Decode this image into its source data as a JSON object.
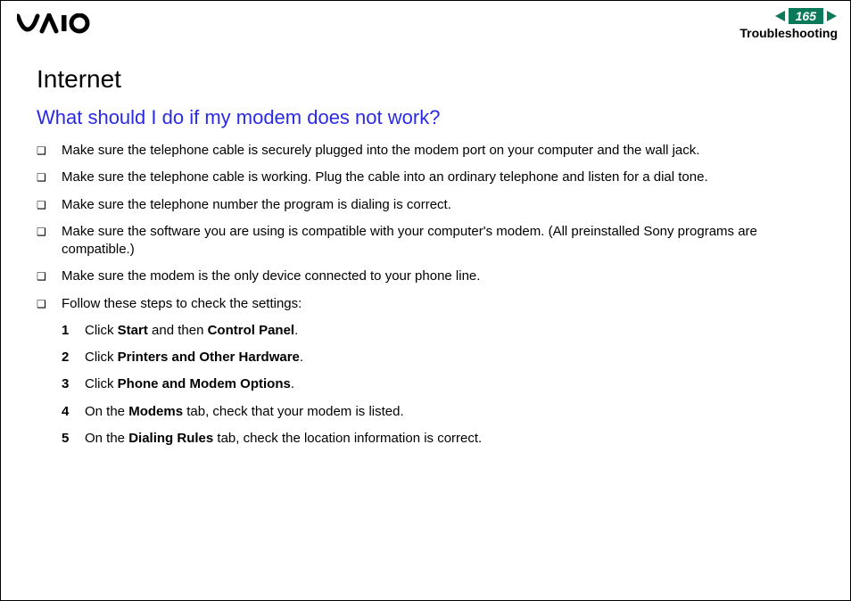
{
  "header": {
    "page_number": "165",
    "section": "Troubleshooting"
  },
  "content": {
    "heading": "Internet",
    "subheading": "What should I do if my modem does not work?",
    "bullets": [
      "Make sure the telephone cable is securely plugged into the modem port on your computer and the wall jack.",
      "Make sure the telephone cable is working. Plug the cable into an ordinary telephone and listen for a dial tone.",
      "Make sure the telephone number the program is dialing is correct.",
      "Make sure the software you are using is compatible with your computer's modem. (All preinstalled Sony programs are compatible.)",
      "Make sure the modem is the only device connected to your phone line.",
      "Follow these steps to check the settings:"
    ],
    "steps": [
      {
        "num": "1",
        "pre": "Click ",
        "b1": "Start",
        "mid": " and then ",
        "b2": "Control Panel",
        "post": "."
      },
      {
        "num": "2",
        "pre": "Click ",
        "b1": "Printers and Other Hardware",
        "mid": "",
        "b2": "",
        "post": "."
      },
      {
        "num": "3",
        "pre": "Click ",
        "b1": "Phone and Modem Options",
        "mid": "",
        "b2": "",
        "post": "."
      },
      {
        "num": "4",
        "pre": "On the ",
        "b1": "Modems",
        "mid": " tab, check that your modem is listed.",
        "b2": "",
        "post": ""
      },
      {
        "num": "5",
        "pre": "On the ",
        "b1": "Dialing Rules",
        "mid": " tab, check the location information is correct.",
        "b2": "",
        "post": ""
      }
    ]
  }
}
